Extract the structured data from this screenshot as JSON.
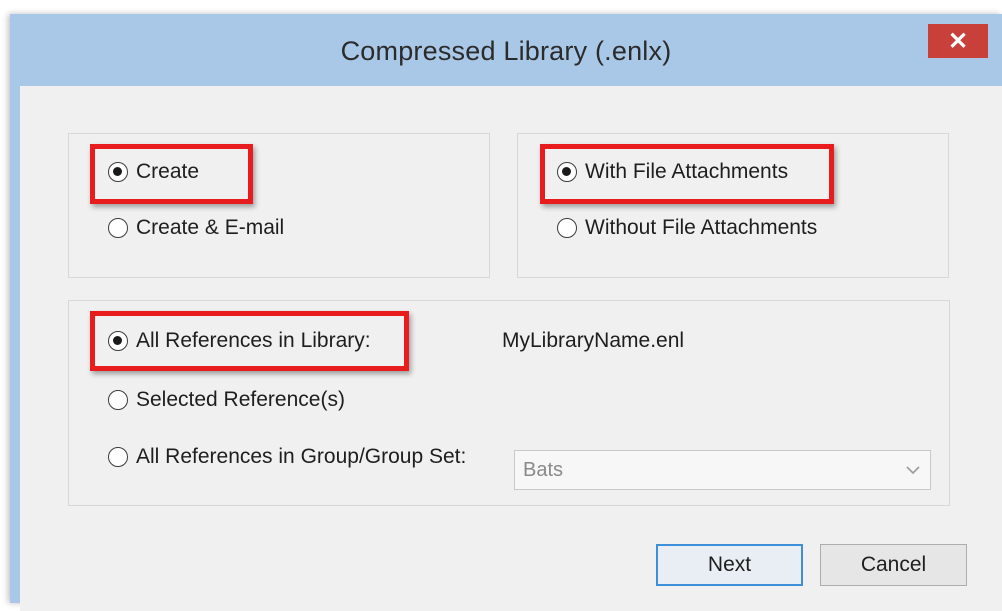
{
  "window": {
    "title": "Compressed Library (.enlx)",
    "close_label": "✕"
  },
  "action_group": {
    "options": [
      {
        "label": "Create",
        "checked": true
      },
      {
        "label": "Create & E-mail",
        "checked": false
      }
    ]
  },
  "attachments_group": {
    "options": [
      {
        "label": "With File Attachments",
        "checked": true
      },
      {
        "label": "Without File Attachments",
        "checked": false
      }
    ]
  },
  "references_group": {
    "options": [
      {
        "label": "All References in Library:",
        "checked": true
      },
      {
        "label": "Selected Reference(s)",
        "checked": false
      },
      {
        "label": "All References in Group/Group Set:",
        "checked": false
      }
    ],
    "library_name": "MyLibraryName.enl",
    "group_select": {
      "value": "Bats"
    }
  },
  "buttons": {
    "next": "Next",
    "cancel": "Cancel"
  },
  "colors": {
    "highlight": "#e81c1c",
    "title_bar": "#a9c8e8",
    "close_button": "#c9403a",
    "default_button_border": "#3c8fd8"
  }
}
